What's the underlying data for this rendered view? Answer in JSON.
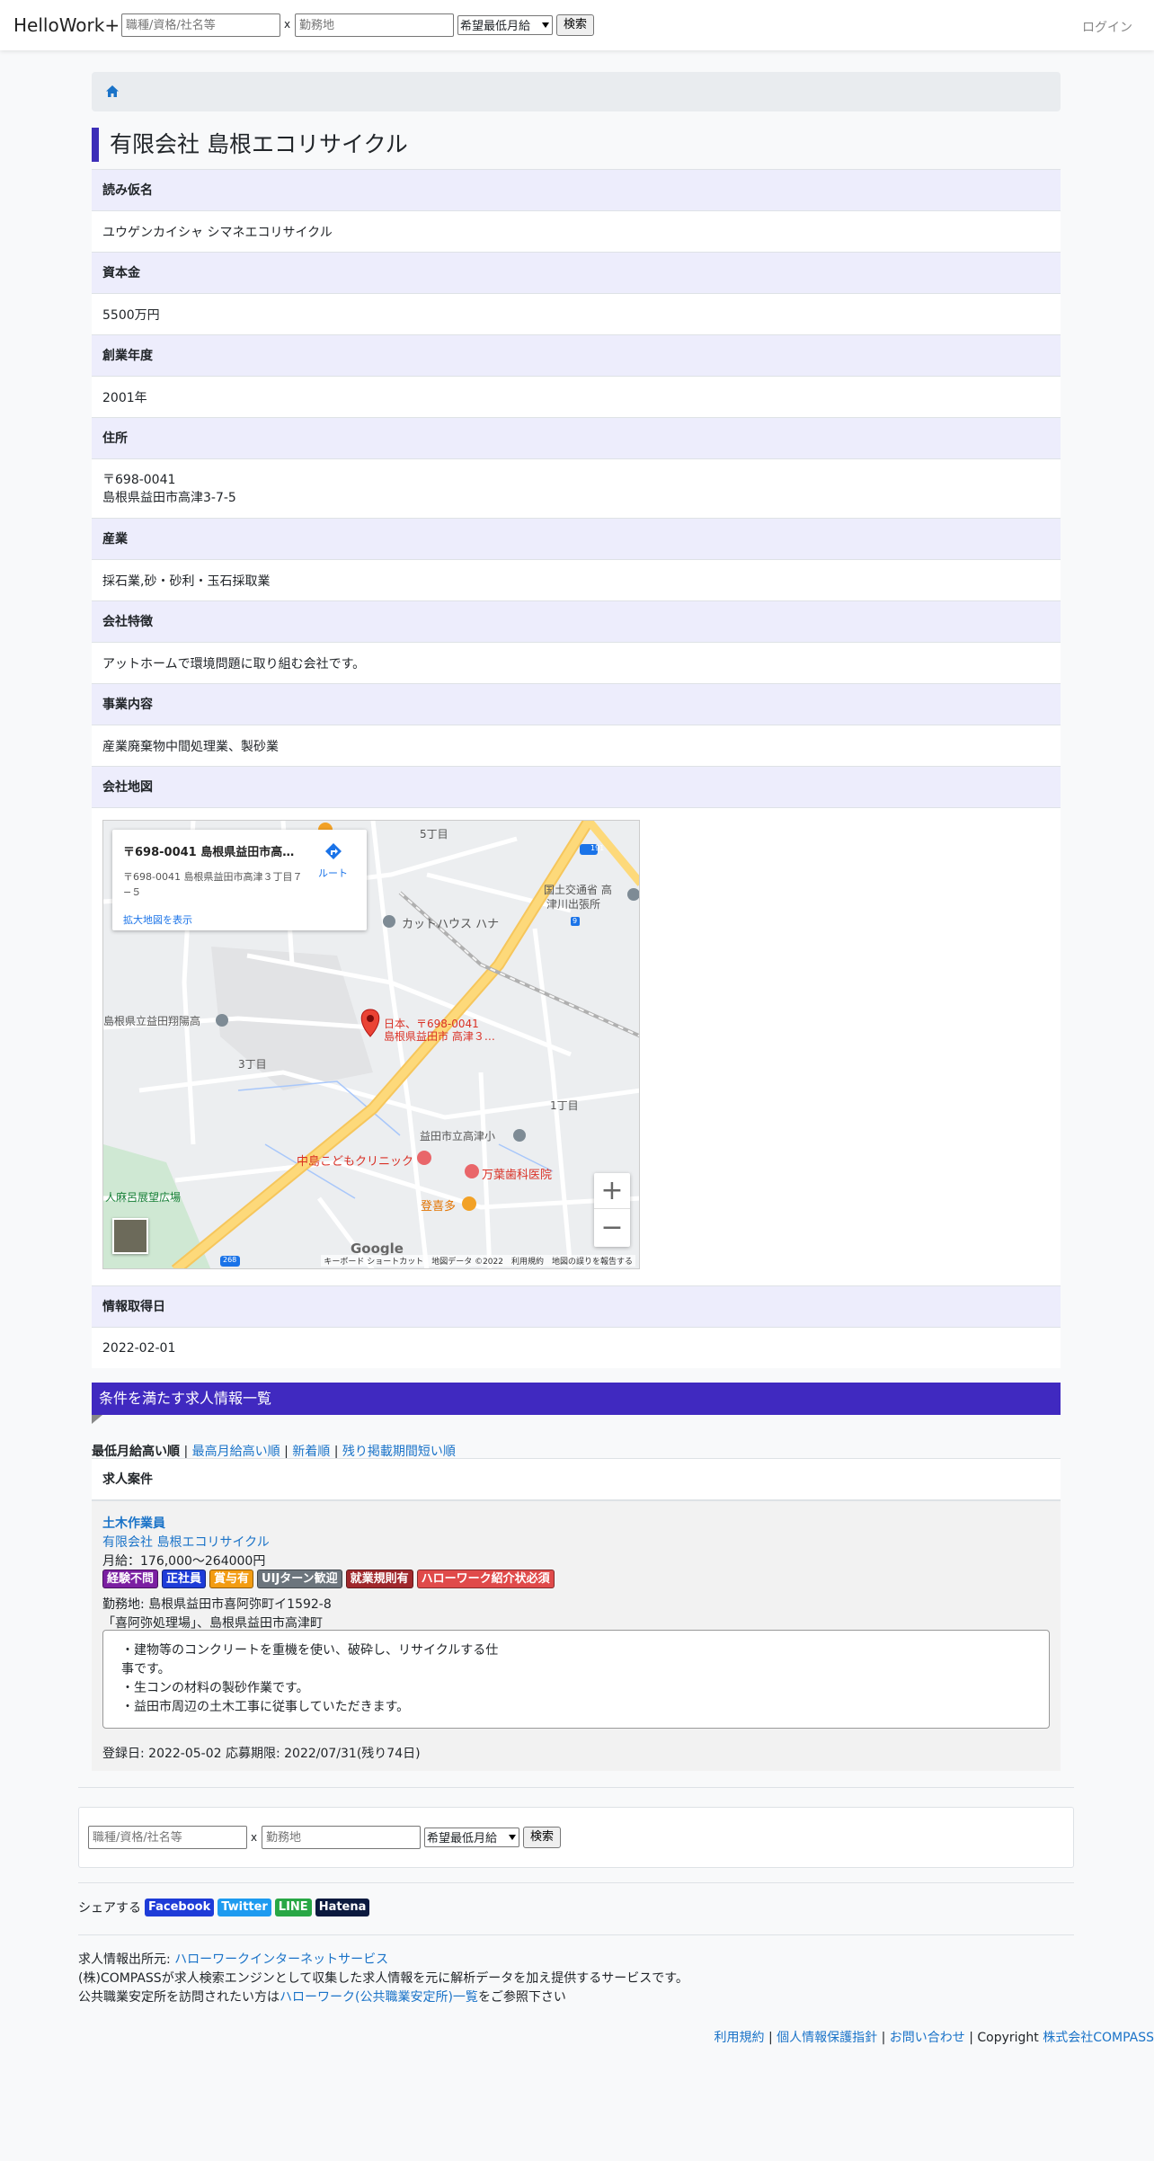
{
  "header": {
    "brand": "HelloWork+",
    "job_placeholder": "職種/資格/社名等",
    "x_sep": "x",
    "location_placeholder": "勤務地",
    "salary_select": "希望最低月給",
    "search_label": "検索",
    "login_label": "ログイン"
  },
  "company": {
    "title": "有限会社 島根エコリサイクル",
    "rows": [
      {
        "label": "読み仮名",
        "value": "ユウゲンカイシャ シマネエコリサイクル"
      },
      {
        "label": "資本金",
        "value": "5500万円"
      },
      {
        "label": "創業年度",
        "value": "2001年"
      },
      {
        "label": "住所",
        "value_line1": "〒698-0041",
        "value_line2": "島根県益田市高津3-7-5"
      },
      {
        "label": "産業",
        "value": "採石業,砂・砂利・玉石採取業"
      },
      {
        "label": "会社特徴",
        "value": "アットホームで環境問題に取り組む会社です。"
      },
      {
        "label": "事業内容",
        "value": "産業廃棄物中間処理業、製砂業"
      },
      {
        "label": "会社地図"
      },
      {
        "label": "情報取得日",
        "value": "2022-02-01"
      }
    ]
  },
  "map": {
    "card_title": "〒698-0041 島根県益田市高津…",
    "card_address": "〒698-0041 島根県益田市高津３丁目７−５",
    "card_link": "拡大地図を表示",
    "route_label": "ルート",
    "labels": {
      "cho5": "5丁目",
      "cho3": "3丁目",
      "cho1": "1丁目",
      "kokudo": "国土交通省 高",
      "kokudo2": "津川出張所",
      "cutt": "カットハウス ハナ",
      "school1": "島根県立益田翔陽高",
      "pin1": "日本、〒698-0041",
      "pin2": "島根県益田市 高津３…",
      "school2": "益田市立高津小",
      "clinic": "中島こどもクリニック",
      "dental": "万葉歯科医院",
      "restaurant": "登喜多",
      "park": "人麻呂展望広場",
      "road191": "191",
      "road9": "9",
      "road268": "268"
    },
    "logo": "Google",
    "footer": "キーボード ショートカット　地図データ ©2022　利用規約　地図の誤りを報告する",
    "colors": {
      "road": "#fdd97a",
      "pin": "#ea4335",
      "bg": "#eceef0"
    }
  },
  "jobs": {
    "section_title": "条件を満たす求人情報一覧",
    "sort_active": "最低月給高い順",
    "sort_sep": "|",
    "sort_links": [
      "最高月給高い順",
      "新着順",
      "残り掲載期間短い順"
    ],
    "table_header": "求人案件",
    "items": [
      {
        "title": "土木作業員",
        "company": "有限会社 島根エコリサイクル",
        "salary": "月給：176,000〜264000円",
        "badges": [
          {
            "label": "経験不問",
            "color": "#7b1fa2"
          },
          {
            "label": "正社員",
            "color": "#1e3cd8"
          },
          {
            "label": "賞与有",
            "color": "#f39c12"
          },
          {
            "label": "UIJターン歓迎",
            "color": "#6c757d"
          },
          {
            "label": "就業規則有",
            "color": "#a0282c"
          },
          {
            "label": "ハローワーク紹介状必須",
            "color": "#e04a4a"
          }
        ],
        "location": "勤務地: 島根県益田市喜阿弥町イ1592-8",
        "location2": "「喜阿弥処理場」、島根県益田市高津町",
        "desc": [
          "・建物等のコンクリートを重機を使い、破砕し、リサイクルする仕",
          "事です。",
          "・生コンの材料の製砂作業です。",
          "・益田市周辺の土木工事に従事していただきます。"
        ],
        "meta": "登録日: 2022-05-02 応募期限: 2022/07/31(残り74日)"
      }
    ]
  },
  "share": {
    "label": "シェアする",
    "buttons": [
      {
        "label": "Facebook",
        "color": "#1e3cd8"
      },
      {
        "label": "Twitter",
        "color": "#1d9bf0"
      },
      {
        "label": "LINE",
        "color": "#28a745"
      },
      {
        "label": "Hatena",
        "color": "#0b1a3f"
      }
    ]
  },
  "source": {
    "line1_prefix": "求人情報出所元: ",
    "line1_link": "ハローワークインターネットサービス",
    "line2": "(株)COMPASSが求人検索エンジンとして収集した求人情報を元に解析データを加え提供するサービスです。",
    "line3_prefix": "公共職業安定所を訪問されたい方は",
    "line3_link": "ハローワーク(公共職業安定所)一覧",
    "line3_suffix": "をご参照下さい"
  },
  "footer": {
    "terms": "利用規約",
    "privacy": "個人情報保護指針",
    "contact": "お問い合わせ",
    "copyright": "| Copyright ",
    "company": "株式会社COMPASS"
  }
}
